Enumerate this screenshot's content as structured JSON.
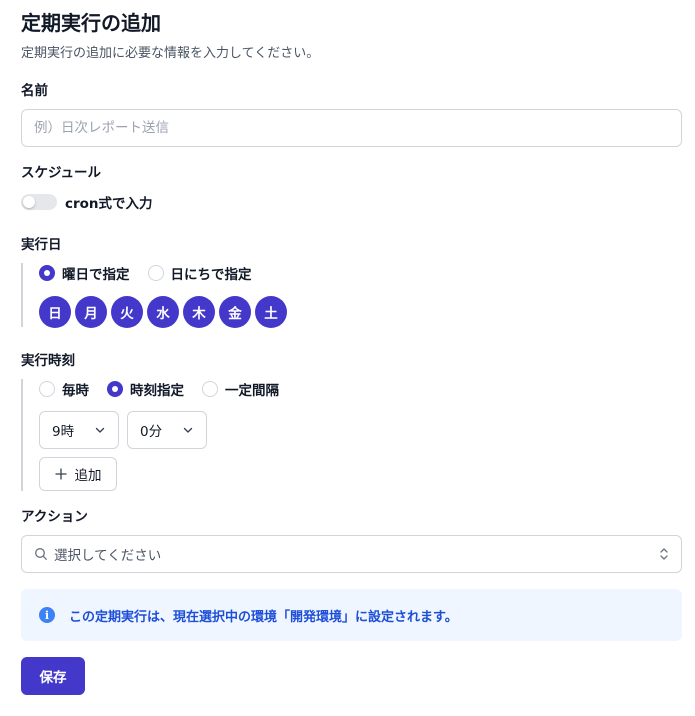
{
  "header": {
    "title": "定期実行の追加",
    "description": "定期実行の追加に必要な情報を入力してください。"
  },
  "name_field": {
    "label": "名前",
    "value": "",
    "placeholder": "例）日次レポート送信"
  },
  "schedule": {
    "label": "スケジュール",
    "cron_toggle_label": "cron式で入力",
    "cron_enabled": false
  },
  "run_day": {
    "label": "実行日",
    "options": [
      {
        "label": "曜日で指定",
        "selected": true
      },
      {
        "label": "日にちで指定",
        "selected": false
      }
    ],
    "weekdays": [
      "日",
      "月",
      "火",
      "水",
      "木",
      "金",
      "土"
    ]
  },
  "run_time": {
    "label": "実行時刻",
    "options": [
      {
        "label": "毎時",
        "selected": false
      },
      {
        "label": "時刻指定",
        "selected": true
      },
      {
        "label": "一定間隔",
        "selected": false
      }
    ],
    "hour_value": "9時",
    "minute_value": "0分",
    "add_label": "追加"
  },
  "action": {
    "label": "アクション",
    "placeholder": "選択してください"
  },
  "alert": {
    "text": "この定期実行は、現在選択中の環境「開発環境」に設定されます。"
  },
  "footer": {
    "save_label": "保存"
  },
  "colors": {
    "accent": "#4338ca",
    "info": "#3b82f6",
    "info_bg": "#eff6ff"
  }
}
